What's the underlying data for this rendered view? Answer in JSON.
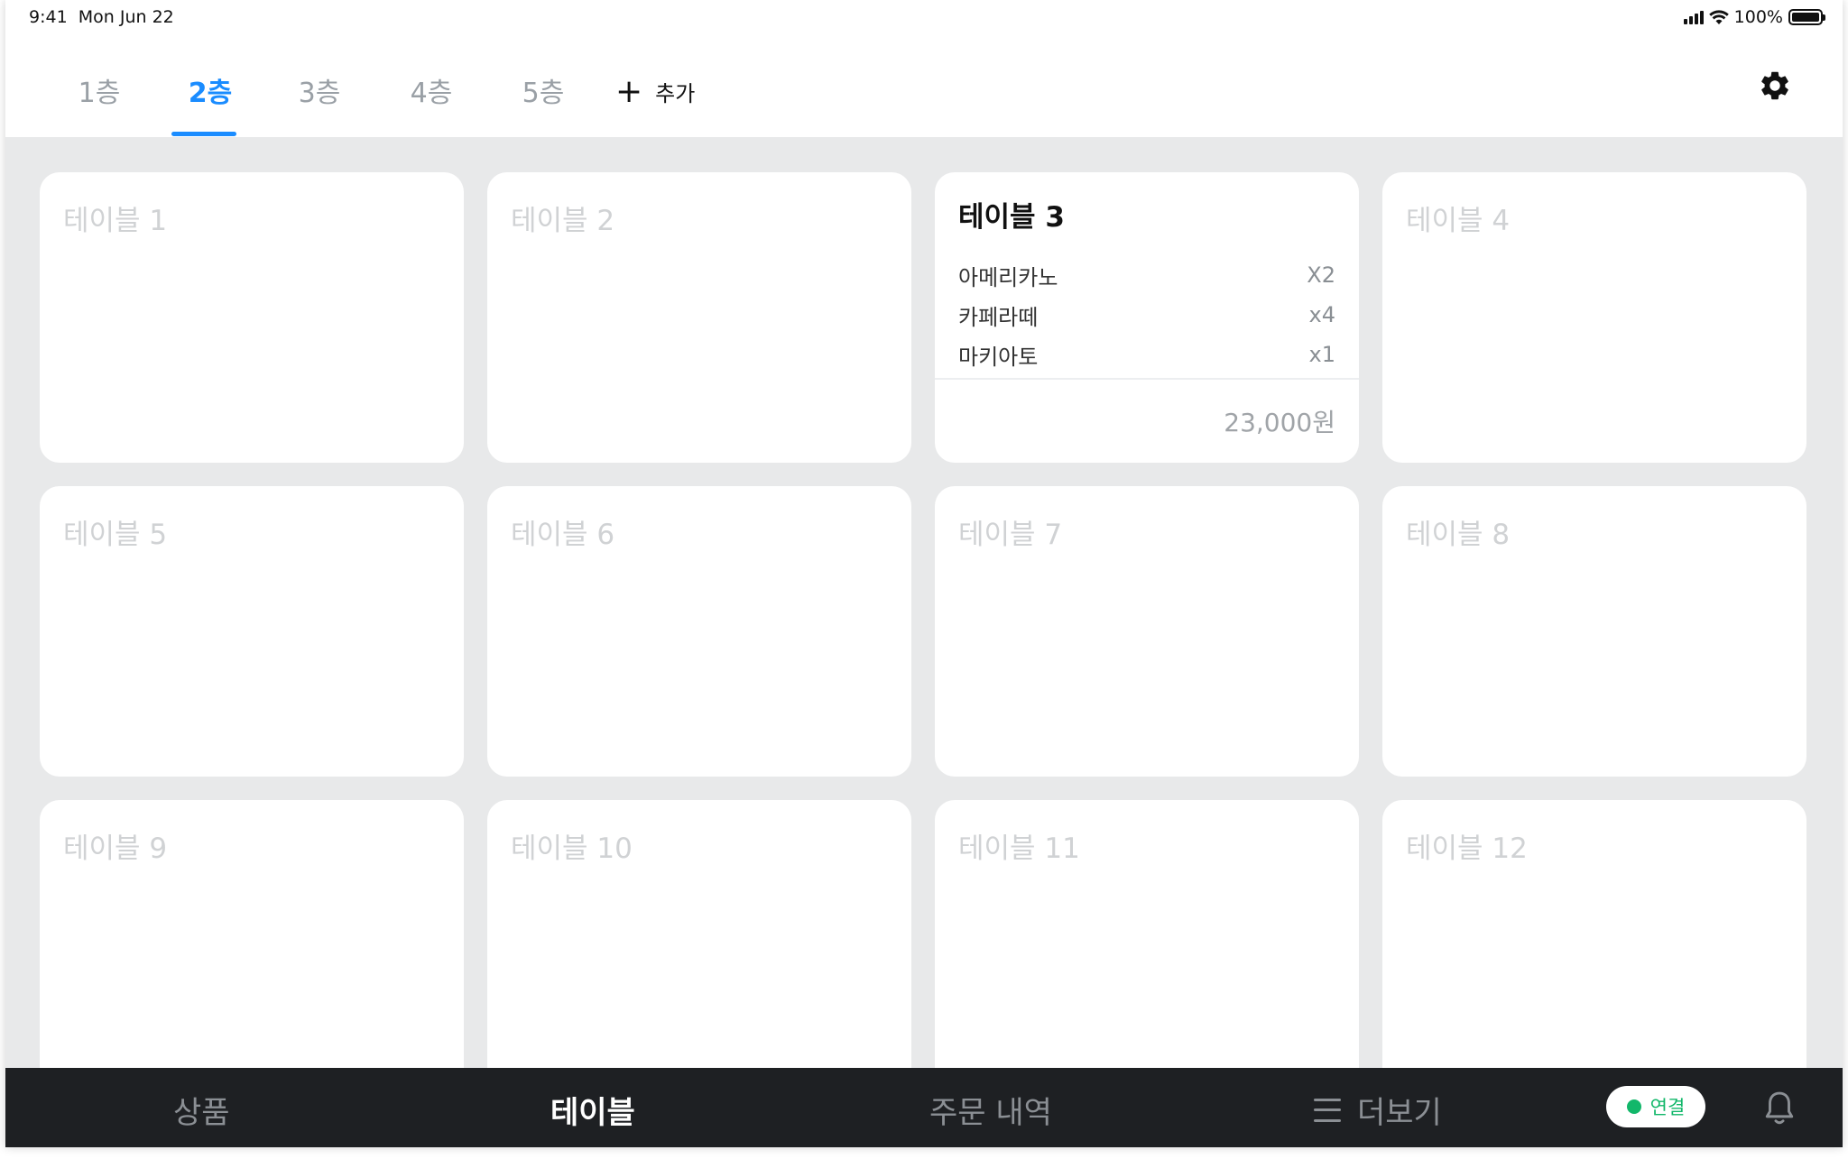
{
  "status_bar": {
    "time": "9:41",
    "date": "Mon Jun 22",
    "battery_percent": "100%",
    "battery_level": 1.0
  },
  "floor_tabs": {
    "items": [
      "1층",
      "2층",
      "3층",
      "4층",
      "5층"
    ],
    "active_index": 1,
    "add_label": "추가",
    "add_icon": "plus-icon",
    "settings_icon": "gear-icon",
    "accent_color": "#1a8cff"
  },
  "tables": [
    {
      "name": "테이블 1"
    },
    {
      "name": "테이블 2"
    },
    {
      "name": "테이블 3",
      "orders": [
        {
          "item": "아메리카노",
          "qty": "X2"
        },
        {
          "item": "카페라떼",
          "qty": "x4"
        },
        {
          "item": "마키아토",
          "qty": "x1"
        }
      ],
      "total": "23,000원"
    },
    {
      "name": "테이블 4"
    },
    {
      "name": "테이블 5"
    },
    {
      "name": "테이블 6"
    },
    {
      "name": "테이블 7"
    },
    {
      "name": "테이블 8"
    },
    {
      "name": "테이블 9"
    },
    {
      "name": "테이블 10"
    },
    {
      "name": "테이블 11"
    },
    {
      "name": "테이블 12"
    }
  ],
  "bottom_nav": {
    "products": "상품",
    "tables": "테이블",
    "order_history": "주문 내역",
    "more": "더보기",
    "more_icon": "hamburger-icon",
    "connection_label": "연결",
    "connection_color": "#12b76a",
    "notification_icon": "bell-icon"
  }
}
